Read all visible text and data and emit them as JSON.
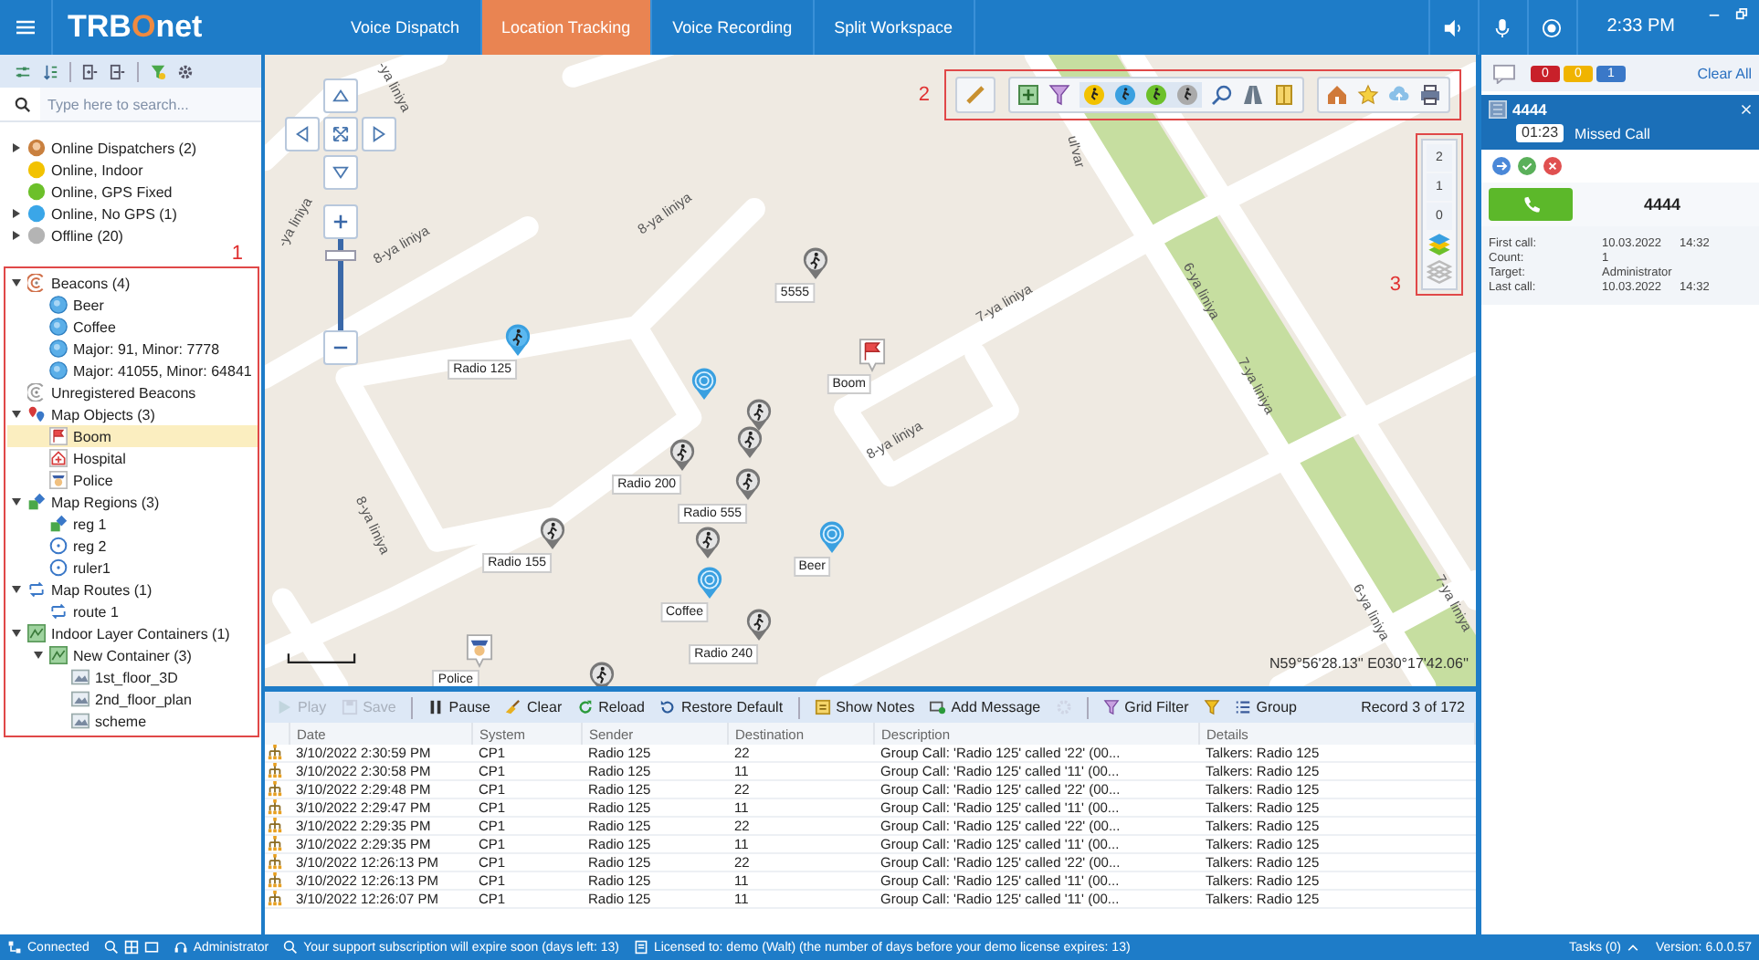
{
  "topbar": {
    "logo": {
      "lead": "TRB",
      "accent": "O",
      "tail": "net"
    },
    "tabs": [
      {
        "label": "Voice Dispatch",
        "selected": false
      },
      {
        "label": "Location Tracking",
        "selected": true
      },
      {
        "label": "Voice Recording",
        "selected": false
      },
      {
        "label": "Split Workspace",
        "selected": false
      }
    ],
    "time": "2:33 PM"
  },
  "sidebar": {
    "search": {
      "placeholder": "Type here to search..."
    },
    "tree": [
      {
        "label": "Online Dispatchers (2)",
        "kind": "dispatcher",
        "expanded": false,
        "selected": false
      },
      {
        "label": "Online, Indoor",
        "kind": "dot",
        "color": "#f2c200",
        "selected": false
      },
      {
        "label": "Online, GPS Fixed",
        "kind": "dot",
        "color": "#6cc02a",
        "selected": false
      },
      {
        "label": "Online, No GPS (1)",
        "kind": "dot",
        "color": "#3aa6e8",
        "expanded": false,
        "selected": false
      },
      {
        "label": "Offline (20)",
        "kind": "dot",
        "color": "#b4b4b4",
        "expanded": false,
        "selected": false
      }
    ],
    "marked_group": {
      "annotation": "1",
      "tree": [
        {
          "label": "Beacons (4)",
          "kind": "radar",
          "expanded": true,
          "selected": false,
          "children": [
            {
              "label": "Beer",
              "kind": "beacon",
              "selected": false
            },
            {
              "label": "Coffee",
              "kind": "beacon",
              "selected": false
            },
            {
              "label": "Major: 91, Minor: 7778",
              "kind": "beacon",
              "selected": false
            },
            {
              "label": "Major: 41055, Minor: 64841",
              "kind": "beacon",
              "selected": false
            }
          ]
        },
        {
          "label": "Unregistered Beacons",
          "kind": "radar-gray",
          "selected": false
        },
        {
          "label": "Map Objects (3)",
          "kind": "pins",
          "expanded": true,
          "selected": false,
          "children": [
            {
              "label": "Boom",
              "kind": "flag",
              "selected": true
            },
            {
              "label": "Hospital",
              "kind": "hospital",
              "selected": false
            },
            {
              "label": "Police",
              "kind": "police",
              "selected": false
            }
          ]
        },
        {
          "label": "Map Regions (3)",
          "kind": "region",
          "expanded": true,
          "selected": false,
          "children": [
            {
              "label": "reg 1",
              "kind": "region",
              "selected": false
            },
            {
              "label": "reg 2",
              "kind": "circle",
              "selected": false
            },
            {
              "label": "ruler1",
              "kind": "circle",
              "selected": false
            }
          ]
        },
        {
          "label": "Map Routes (1)",
          "kind": "route",
          "expanded": true,
          "selected": false,
          "children": [
            {
              "label": "route 1",
              "kind": "route",
              "selected": false
            }
          ]
        },
        {
          "label": "Indoor Layer Containers (1)",
          "kind": "container",
          "expanded": true,
          "selected": false,
          "children": [
            {
              "label": "New Container (3)",
              "kind": "container",
              "expanded": true,
              "selected": false,
              "children": [
                {
                  "label": "1st_floor_3D",
                  "kind": "image",
                  "selected": false
                },
                {
                  "label": "2nd_floor_plan",
                  "kind": "image",
                  "selected": false
                },
                {
                  "label": "scheme",
                  "kind": "image",
                  "selected": false
                }
              ]
            }
          ]
        }
      ]
    }
  },
  "map": {
    "streets": [
      "-ya liniya",
      "8-ya liniya",
      "8-ya liniya",
      "8-ya liniya",
      "8-ya liniya",
      "7-ya liniya",
      "6-ya liniya",
      "7-ya liniya",
      "6-ya liniya",
      "ul'var",
      "-ya liniya",
      "7-ya liniya"
    ],
    "markers": [
      {
        "kind": "radio",
        "online": true,
        "label": "Radio 125"
      },
      {
        "kind": "radio",
        "online": false,
        "label": "5555"
      },
      {
        "kind": "flag",
        "label": "Boom"
      },
      {
        "kind": "beacon"
      },
      {
        "kind": "radio",
        "online": false
      },
      {
        "kind": "radio",
        "online": false
      },
      {
        "kind": "radio",
        "online": false,
        "label": "Radio 200"
      },
      {
        "kind": "radio",
        "online": false,
        "label": "Radio 555"
      },
      {
        "kind": "radio",
        "online": false,
        "label": "Radio 155"
      },
      {
        "kind": "beacon",
        "label": "Beer"
      },
      {
        "kind": "radio",
        "online": false
      },
      {
        "kind": "beacon",
        "label": "Coffee"
      },
      {
        "kind": "radio",
        "online": false,
        "label": "Radio 240"
      },
      {
        "kind": "police",
        "label": "Police"
      },
      {
        "kind": "radio",
        "online": false
      }
    ],
    "zoom_slider": {
      "level": 0.85
    },
    "toolbar_annotation": "2",
    "layers": {
      "annotation": "3",
      "floors": [
        {
          "label": "2",
          "selected": false
        },
        {
          "label": "1",
          "selected": false
        },
        {
          "label": "0",
          "selected": false
        }
      ]
    },
    "coordinates": "N59°56'28.13'' E030°17'42.06''"
  },
  "grid": {
    "toolbar": [
      [
        {
          "kind": "play",
          "label": "Play",
          "disabled": true
        },
        {
          "kind": "save",
          "label": "Save",
          "disabled": true
        }
      ],
      [
        {
          "kind": "pause",
          "label": "Pause",
          "disabled": false
        },
        {
          "kind": "clear",
          "label": "Clear",
          "disabled": false
        },
        {
          "kind": "reload",
          "label": "Reload",
          "disabled": false
        },
        {
          "kind": "restore",
          "label": "Restore Default",
          "disabled": false
        }
      ],
      [
        {
          "kind": "notes",
          "label": "Show Notes",
          "disabled": false
        },
        {
          "kind": "message",
          "label": "Add Message",
          "disabled": false
        },
        {
          "kind": "gear",
          "disabled": true
        }
      ],
      [
        {
          "kind": "gridfilter",
          "label": "Grid Filter",
          "disabled": false
        },
        {
          "kind": "filter",
          "disabled": false
        },
        {
          "kind": "group",
          "label": "Group",
          "disabled": false
        }
      ]
    ],
    "record": "Record 3 of 172",
    "columns": [
      "Date",
      "System",
      "Sender",
      "Destination",
      "Description",
      "Details"
    ],
    "rows": [
      [
        "3/10/2022 2:30:59 PM",
        "CP1",
        "Radio 125",
        "22",
        "Group Call: 'Radio 125' called '22' (00...",
        "Talkers: Radio 125"
      ],
      [
        "3/10/2022 2:30:58 PM",
        "CP1",
        "Radio 125",
        "11",
        "Group Call: 'Radio 125' called '11' (00...",
        "Talkers: Radio 125"
      ],
      [
        "3/10/2022 2:29:48 PM",
        "CP1",
        "Radio 125",
        "22",
        "Group Call: 'Radio 125' called '22' (00...",
        "Talkers: Radio 125"
      ],
      [
        "3/10/2022 2:29:47 PM",
        "CP1",
        "Radio 125",
        "11",
        "Group Call: 'Radio 125' called '11' (00...",
        "Talkers: Radio 125"
      ],
      [
        "3/10/2022 2:29:35 PM",
        "CP1",
        "Radio 125",
        "22",
        "Group Call: 'Radio 125' called '22' (00...",
        "Talkers: Radio 125"
      ],
      [
        "3/10/2022 2:29:35 PM",
        "CP1",
        "Radio 125",
        "11",
        "Group Call: 'Radio 125' called '11' (00...",
        "Talkers: Radio 125"
      ],
      [
        "3/10/2022 12:26:13 PM",
        "CP1",
        "Radio 125",
        "22",
        "Group Call: 'Radio 125' called '22' (00...",
        "Talkers: Radio 125"
      ],
      [
        "3/10/2022 12:26:13 PM",
        "CP1",
        "Radio 125",
        "11",
        "Group Call: 'Radio 125' called '11' (00...",
        "Talkers: Radio 125"
      ],
      [
        "3/10/2022 12:26:07 PM",
        "CP1",
        "Radio 125",
        "11",
        "Group Call: 'Radio 125' called '11' (00...",
        "Talkers: Radio 125"
      ]
    ]
  },
  "calls": {
    "counters": [
      {
        "value": "0",
        "color": "#c8202a"
      },
      {
        "value": "0",
        "color": "#f0b400"
      },
      {
        "value": "1",
        "color": "#3a78c8"
      }
    ],
    "clear_all": "Clear All",
    "card": {
      "number": "4444",
      "duration": "01:23",
      "status": "Missed Call"
    },
    "callback_number": "4444",
    "details": [
      {
        "label": "First call:",
        "value": "10.03.2022",
        "time": "14:32"
      },
      {
        "label": "Count:",
        "value": "1"
      },
      {
        "label": "Target:",
        "value": "Administrator"
      },
      {
        "label": "Last call:",
        "value": "10.03.2022",
        "time": "14:32"
      }
    ]
  },
  "status_bar": [
    {
      "kind": "connected",
      "text": "Connected"
    },
    {
      "kind": "tools"
    },
    {
      "kind": "user",
      "text": "Administrator"
    },
    {
      "kind": "warning",
      "text": "Your support subscription will expire soon (days left: 13)"
    },
    {
      "kind": "license",
      "text": "Licensed to: demo (Walt) (the number of days before your demo license expires: 13)"
    },
    {
      "kind": "tasks",
      "text": "Tasks (0)"
    },
    {
      "kind": "version",
      "text": "Version: 6.0.0.57"
    }
  ]
}
